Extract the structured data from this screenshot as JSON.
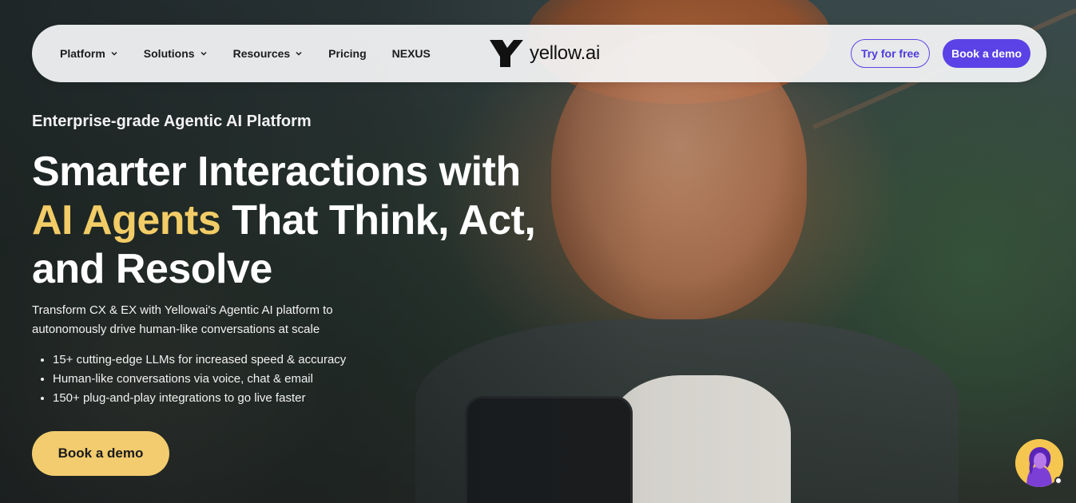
{
  "nav": {
    "items": [
      {
        "label": "Platform",
        "has_dropdown": true
      },
      {
        "label": "Solutions",
        "has_dropdown": true
      },
      {
        "label": "Resources",
        "has_dropdown": true
      },
      {
        "label": "Pricing",
        "has_dropdown": false
      },
      {
        "label": "NEXUS",
        "has_dropdown": false
      }
    ],
    "logo_text": "yellow.ai",
    "try_free_label": "Try for free",
    "book_demo_label": "Book a demo"
  },
  "hero": {
    "eyebrow": "Enterprise-grade Agentic AI Platform",
    "headline_part1": "Smarter Interactions with",
    "headline_accent": "AI Agents",
    "headline_part2": "That Think, Act,",
    "headline_part3": "and Resolve",
    "description_line1": "Transform CX & EX with Yellowai's Agentic AI platform to",
    "description_line2": "autonomously drive human-like conversations at scale",
    "bullets": [
      "15+ cutting-edge LLMs for increased speed & accuracy",
      "Human-like conversations via voice, chat & email",
      "150+ plug-and-play integrations to go live faster"
    ],
    "cta_label": "Book a demo"
  },
  "colors": {
    "accent_yellow": "#f2cc66",
    "brand_purple": "#5a42e6",
    "cta_yellow": "#f2cc6e"
  },
  "icons": {
    "logo": "yellow-ai-logo-icon",
    "dropdown": "chevron-down-icon",
    "chat": "chat-assistant-avatar-icon"
  }
}
